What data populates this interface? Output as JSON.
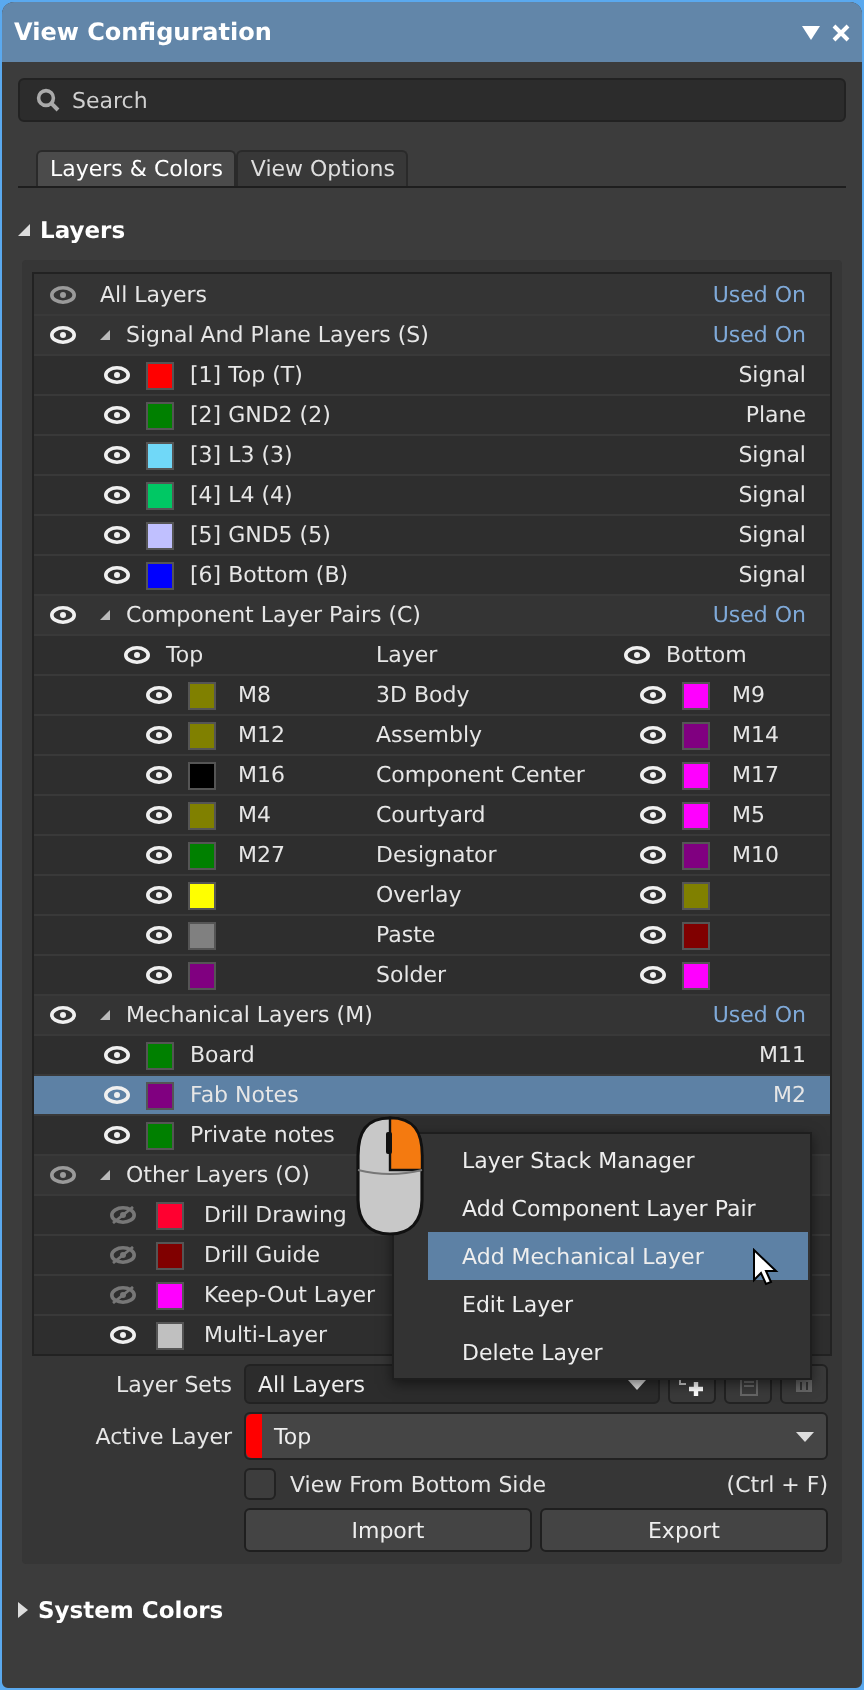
{
  "window": {
    "title": "View Configuration"
  },
  "search": {
    "placeholder": "Search"
  },
  "tabs": [
    {
      "label": "Layers & Colors",
      "selected": true
    },
    {
      "label": "View Options",
      "selected": false
    }
  ],
  "layers_section": {
    "title": "Layers",
    "expanded": true,
    "all_layers": {
      "label": "All Layers",
      "column": "Used On",
      "visible": true,
      "partial": true
    },
    "groups": [
      {
        "kind": "simple",
        "label": "Signal And Plane Layers (S)",
        "column": "Used On",
        "expanded": true,
        "visible": true,
        "partial": false,
        "items": [
          {
            "name": "[1] Top (T)",
            "color": "#ff0000",
            "used_on": "Signal",
            "visible": true,
            "selected": false
          },
          {
            "name": "[2] GND2 (2)",
            "color": "#008000",
            "used_on": "Plane",
            "visible": true,
            "selected": false
          },
          {
            "name": "[3] L3 (3)",
            "color": "#70d8f8",
            "used_on": "Signal",
            "visible": true,
            "selected": false
          },
          {
            "name": "[4] L4 (4)",
            "color": "#00c864",
            "used_on": "Signal",
            "visible": true,
            "selected": false
          },
          {
            "name": "[5] GND5 (5)",
            "color": "#c0c0ff",
            "used_on": "Signal",
            "visible": true,
            "selected": false
          },
          {
            "name": "[6] Bottom (B)",
            "color": "#0000ff",
            "used_on": "Signal",
            "visible": true,
            "selected": false
          }
        ]
      },
      {
        "kind": "pairs",
        "label": "Component Layer Pairs (C)",
        "column": "Used On",
        "expanded": true,
        "visible": true,
        "partial": false,
        "header": {
          "top": "Top",
          "layer": "Layer",
          "bottom": "Bottom"
        },
        "pairs": [
          {
            "top": {
              "name": "M8",
              "color": "#808000"
            },
            "layer": "3D Body",
            "bottom": {
              "name": "M9",
              "color": "#ff00ff"
            }
          },
          {
            "top": {
              "name": "M12",
              "color": "#808000"
            },
            "layer": "Assembly",
            "bottom": {
              "name": "M14",
              "color": "#800080"
            }
          },
          {
            "top": {
              "name": "M16",
              "color": "#000000"
            },
            "layer": "Component Center",
            "bottom": {
              "name": "M17",
              "color": "#ff00ff"
            }
          },
          {
            "top": {
              "name": "M4",
              "color": "#808000"
            },
            "layer": "Courtyard",
            "bottom": {
              "name": "M5",
              "color": "#ff00ff"
            }
          },
          {
            "top": {
              "name": "M27",
              "color": "#008000"
            },
            "layer": "Designator",
            "bottom": {
              "name": "M10",
              "color": "#800080"
            }
          },
          {
            "top": {
              "color": "#ffff00"
            },
            "layer": "Overlay",
            "bottom": {
              "color": "#808000"
            }
          },
          {
            "top": {
              "color": "#808080"
            },
            "layer": "Paste",
            "bottom": {
              "color": "#800000"
            }
          },
          {
            "top": {
              "color": "#800080"
            },
            "layer": "Solder",
            "bottom": {
              "color": "#ff00ff"
            }
          }
        ]
      },
      {
        "kind": "simple",
        "label": "Mechanical Layers (M)",
        "column": "Used On",
        "expanded": true,
        "visible": true,
        "partial": false,
        "items": [
          {
            "name": "Board",
            "color": "#008000",
            "used_on": "M11",
            "visible": true,
            "selected": false
          },
          {
            "name": "Fab Notes",
            "color": "#800080",
            "used_on": "M2",
            "visible": true,
            "selected": true
          },
          {
            "name": "Private notes",
            "color": "#008000",
            "visible": true,
            "selected": false
          }
        ]
      },
      {
        "kind": "simple",
        "label": "Other Layers (O)",
        "expanded": true,
        "visible": true,
        "partial": true,
        "items": [
          {
            "name": "Drill Drawing",
            "color": "#ff0030",
            "visible": false,
            "selected": false
          },
          {
            "name": "Drill Guide",
            "color": "#800000",
            "visible": false,
            "selected": false
          },
          {
            "name": "Keep-Out Layer",
            "color": "#ff00ff",
            "visible": false,
            "selected": false
          },
          {
            "name": "Multi-Layer",
            "color": "#c0c0c0",
            "visible": true,
            "selected": false
          }
        ]
      }
    ]
  },
  "layer_sets": {
    "label": "Layer Sets",
    "value": "All Layers"
  },
  "active_layer": {
    "label": "Active Layer",
    "value": "Top",
    "color": "#ff0000"
  },
  "view_from_bottom": {
    "label": "View From Bottom Side",
    "checked": false,
    "shortcut": "(Ctrl + F)"
  },
  "buttons": [
    "Import",
    "Export"
  ],
  "system_colors": {
    "title": "System Colors",
    "expanded": false
  },
  "context_menu": {
    "items": [
      {
        "label": "Layer Stack Manager",
        "selected": false
      },
      {
        "label": "Add Component Layer Pair",
        "selected": false
      },
      {
        "label": "Add Mechanical Layer",
        "selected": true
      },
      {
        "label": "Edit Layer",
        "selected": false
      },
      {
        "label": "Delete Layer",
        "selected": false
      }
    ]
  }
}
